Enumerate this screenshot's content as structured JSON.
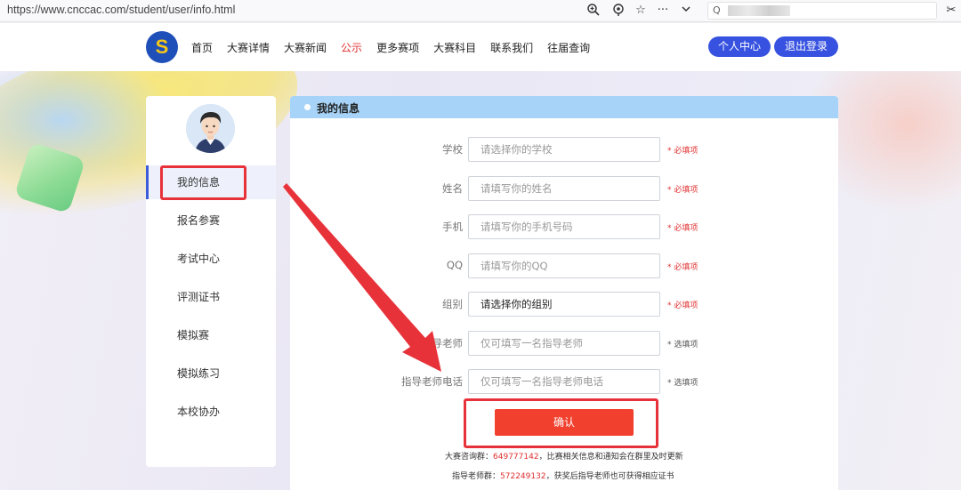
{
  "browser": {
    "url": "https://www.cnccac.com/student/user/info.html",
    "icons": [
      "zoom-icon",
      "location-icon",
      "star-icon",
      "more-icon",
      "chevron-down-icon",
      "search-icon",
      "scissors-icon"
    ]
  },
  "header": {
    "logo_text": "S",
    "nav": [
      "首页",
      "大赛详情",
      "大赛新闻",
      "公示",
      "更多赛项",
      "大赛科目",
      "联系我们",
      "往届查询"
    ],
    "active_nav": "公示",
    "personal_center": "个人中心",
    "logout": "退出登录"
  },
  "sidebar": {
    "items": [
      "我的信息",
      "报名参赛",
      "考试中心",
      "评测证书",
      "模拟赛",
      "模拟练习",
      "本校协办"
    ],
    "active": "我的信息"
  },
  "panel": {
    "title": "我的信息",
    "fields": [
      {
        "label": "学校",
        "placeholder": "请选择你的学校",
        "tag": "* 必填项"
      },
      {
        "label": "姓名",
        "placeholder": "请填写你的姓名",
        "tag": "* 必填项"
      },
      {
        "label": "手机",
        "placeholder": "请填写你的手机号码",
        "tag": "* 必填项"
      },
      {
        "label": "QQ",
        "placeholder": "请填写你的QQ",
        "tag": "* 必填项"
      },
      {
        "label": "组别",
        "placeholder": "请选择你的组别",
        "tag": "* 必填项"
      },
      {
        "label": "指导老师",
        "placeholder": "仅可填写一名指导老师",
        "tag": "* 选填项"
      },
      {
        "label": "指导老师电话",
        "placeholder": "仅可填写一名指导老师电话",
        "tag": "* 选填项"
      }
    ],
    "confirm": "确认",
    "note1_prefix": "大赛咨询群：",
    "note1_num": "649777142",
    "note1_suffix": "，比赛相关信息和通知会在群里及时更新",
    "note2_prefix": "指导老师群：",
    "note2_num": "572249132",
    "note2_suffix": "，获奖后指导老师也可获得相应证书"
  },
  "colors": {
    "accent_blue": "#3752e0",
    "confirm_red": "#f1402e",
    "panel_head": "#a6d3f7",
    "annotation_red": "#e8323a"
  }
}
